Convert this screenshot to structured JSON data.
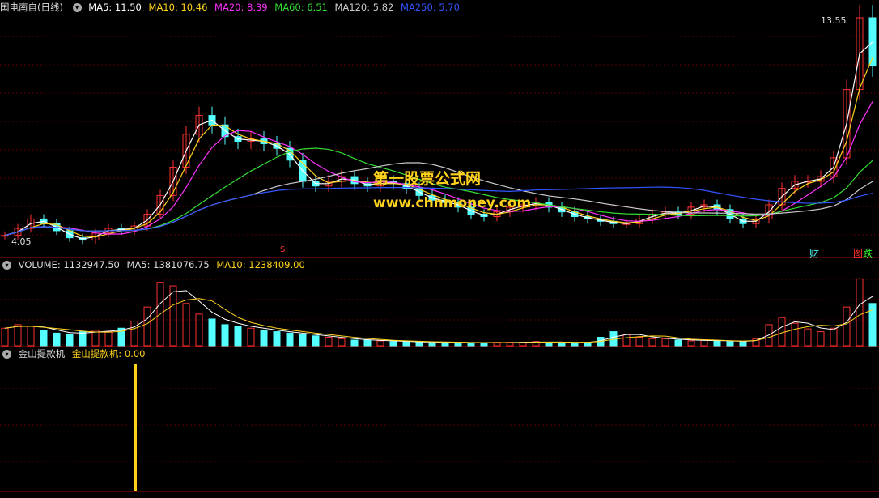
{
  "stock": {
    "name": "国电南自(日线)",
    "ma_labels": [
      {
        "text": "MA5: 11.50",
        "color": "#ffffff"
      },
      {
        "text": "MA10: 10.46",
        "color": "#ffd21c"
      },
      {
        "text": "MA20: 8.39",
        "color": "#ff33ff"
      },
      {
        "text": "MA60: 6.51",
        "color": "#33dd33"
      },
      {
        "text": "MA120: 5.82",
        "color": "#cccccc"
      },
      {
        "text": "MA250: 5.70",
        "color": "#3355ff"
      }
    ],
    "price_high": "13.55",
    "price_low": "4.05",
    "marker_s": "S"
  },
  "volume": {
    "title": "VOLUME: 1132947.50",
    "ma5": "MA5: 1381076.75",
    "ma10": "MA10: 1238409.00"
  },
  "indicator": {
    "name": "金山提款机",
    "value_label": "金山提款机: 0.00"
  },
  "badges": {
    "cai": "财",
    "die": "跌",
    "die_prefix": "图"
  },
  "overlay": {
    "title": "第一股票公式网",
    "url": "www.chnmoney.com"
  },
  "colors": {
    "up": "#ff3232",
    "down": "#54ffff",
    "grid": "#5a0000",
    "accent": "#ffd21c"
  },
  "chart_data": {
    "type": "candlestick",
    "close_trend": [
      4.3,
      4.6,
      5.0,
      4.8,
      4.5,
      4.2,
      4.1,
      4.4,
      4.6,
      4.5,
      4.7,
      5.2,
      6.0,
      7.2,
      8.6,
      9.4,
      9.0,
      8.5,
      8.3,
      8.4,
      8.2,
      8.0,
      7.5,
      6.6,
      6.4,
      6.6,
      6.8,
      6.5,
      6.4,
      6.6,
      6.5,
      6.3,
      6.0,
      5.8,
      5.7,
      5.5,
      5.2,
      5.1,
      5.3,
      5.5,
      5.6,
      5.7,
      5.5,
      5.3,
      5.1,
      5.0,
      4.9,
      4.8,
      4.8,
      5.0,
      5.2,
      5.3,
      5.2,
      5.5,
      5.6,
      5.4,
      5.0,
      4.8,
      5.0,
      5.6,
      6.3,
      6.6,
      6.6,
      6.8,
      7.6,
      10.5,
      13.55,
      11.5
    ],
    "volume_trend": [
      0.25,
      0.3,
      0.28,
      0.22,
      0.18,
      0.16,
      0.2,
      0.22,
      0.2,
      0.25,
      0.35,
      0.55,
      0.9,
      0.85,
      0.6,
      0.45,
      0.38,
      0.3,
      0.28,
      0.25,
      0.22,
      0.2,
      0.18,
      0.16,
      0.14,
      0.12,
      0.1,
      0.08,
      0.08,
      0.07,
      0.06,
      0.06,
      0.05,
      0.05,
      0.05,
      0.05,
      0.04,
      0.04,
      0.05,
      0.05,
      0.05,
      0.06,
      0.05,
      0.05,
      0.04,
      0.05,
      0.12,
      0.2,
      0.16,
      0.12,
      0.1,
      0.1,
      0.08,
      0.07,
      0.08,
      0.07,
      0.06,
      0.06,
      0.1,
      0.3,
      0.4,
      0.32,
      0.24,
      0.2,
      0.25,
      0.55,
      0.95,
      0.6
    ],
    "signal_spike_value": 1.0
  }
}
